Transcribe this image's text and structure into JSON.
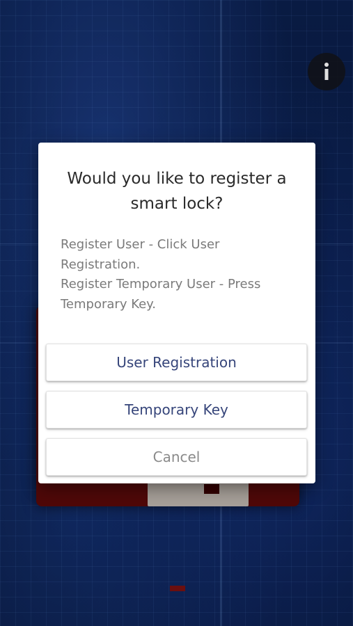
{
  "dialog": {
    "title": "Would you like to register a smart lock?",
    "message_lines": [
      "Register User - Click User Registration.",
      "Register Temporary User - Press Temporary Key."
    ],
    "buttons": {
      "user_registration": "User Registration",
      "temporary_key": "Temporary Key",
      "cancel": "Cancel"
    }
  },
  "info_button": {
    "icon": "info-icon"
  },
  "colors": {
    "primary_button_text": "#36457a",
    "cancel_button_text": "#8a8a8a",
    "background_blue": "#0b1f4d",
    "device_red": "#5a0a0a"
  }
}
